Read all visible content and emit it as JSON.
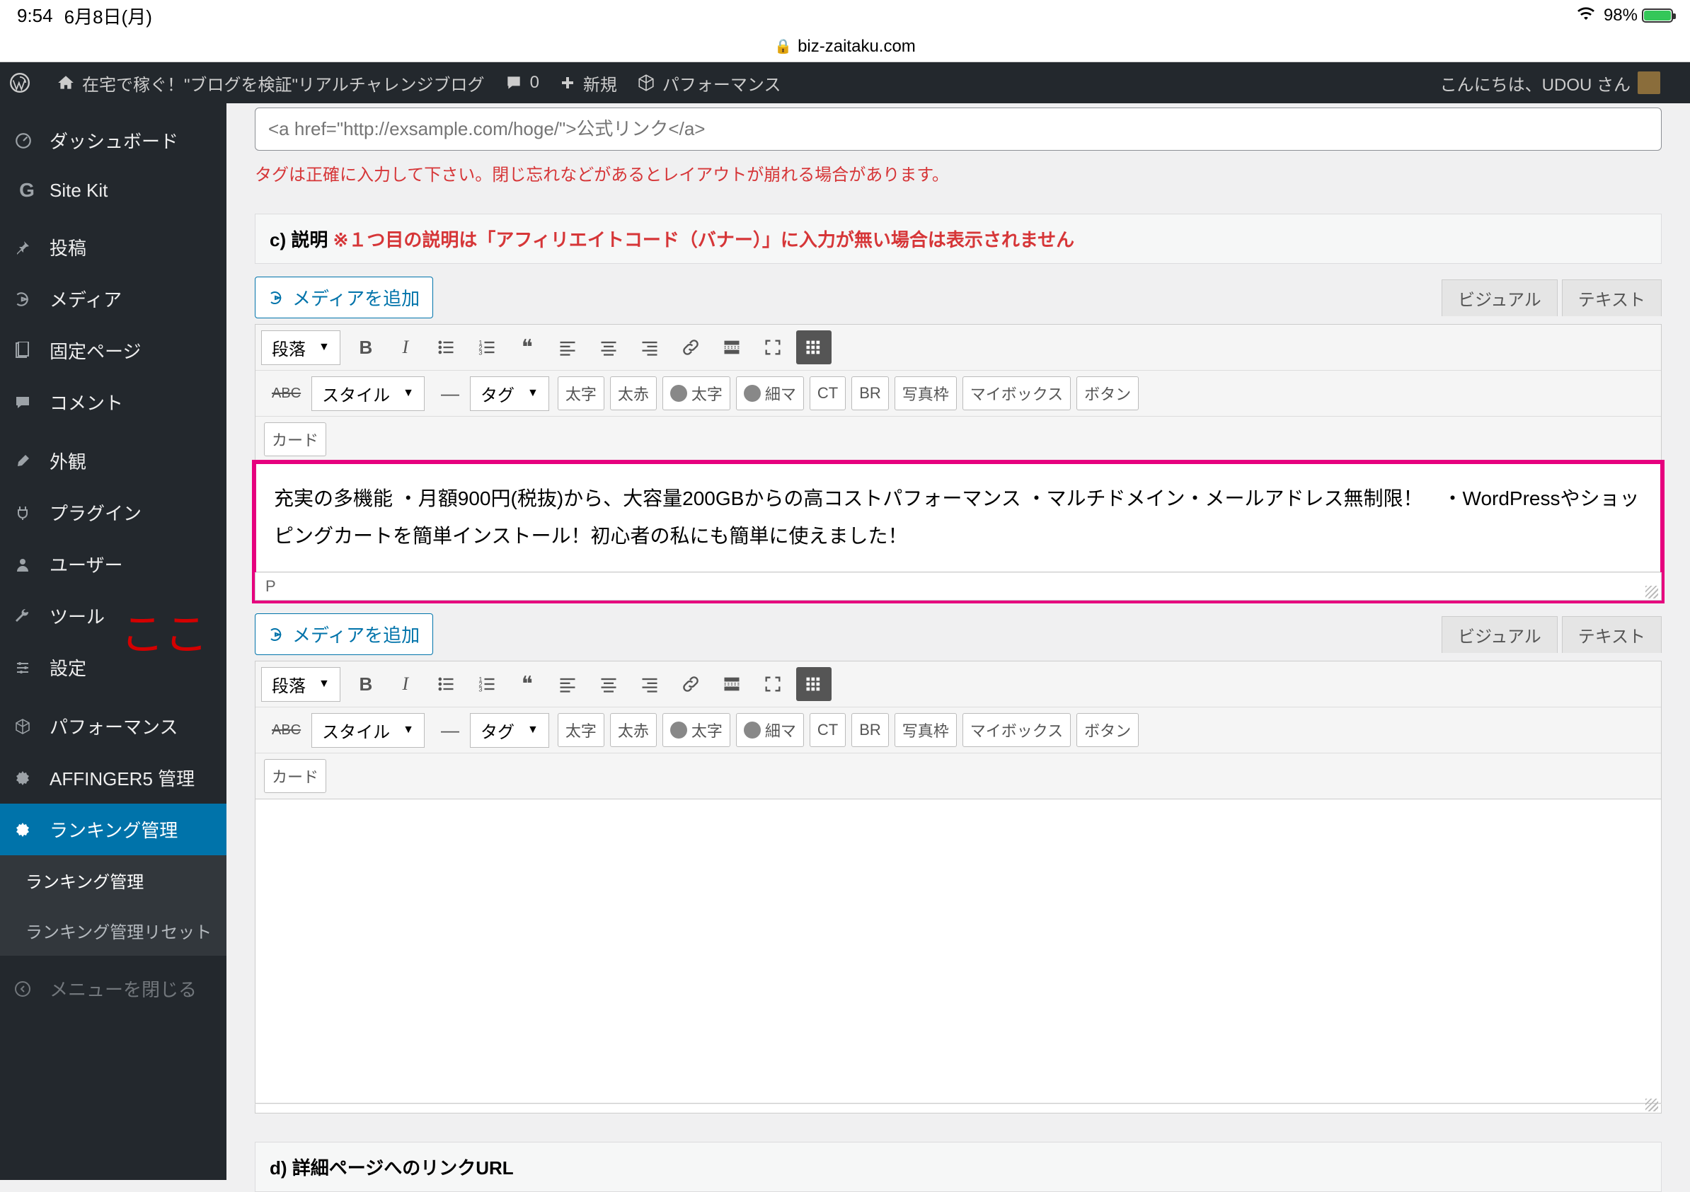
{
  "ios": {
    "time": "9:54",
    "date": "6月8日(月)",
    "battery": "98%",
    "url_host": "biz-zaitaku.com"
  },
  "adminbar": {
    "site_title": "在宅で稼ぐ！\"ブログを検証\"リアルチャレンジブログ",
    "comments": "0",
    "new": "新規",
    "performance": "パフォーマンス",
    "greeting": "こんにちは、UDOU さん"
  },
  "sidebar": {
    "dashboard": "ダッシュボード",
    "sitekit": "Site Kit",
    "posts": "投稿",
    "media": "メディア",
    "pages": "固定ページ",
    "comments": "コメント",
    "appearance": "外観",
    "plugins": "プラグイン",
    "users": "ユーザー",
    "tools": "ツール",
    "settings": "設定",
    "performance": "パフォーマンス",
    "affinger": "AFFINGER5 管理",
    "ranking": "ランキング管理",
    "sub_ranking": "ランキング管理",
    "sub_ranking_reset": "ランキング管理リセット",
    "collapse": "メニューを閉じる"
  },
  "content": {
    "annotation": "ここ",
    "link_placeholder": "<a href=\"http://exsample.com/hoge/\">公式リンク</a>",
    "link_hint": "タグは正確に入力して下さい。閉じ忘れなどがあるとレイアウトが崩れる場合があります。",
    "section_c_label": "c) 説明",
    "section_c_note": "※１つ目の説明は「アフィリエイトコード（バナー）」に入力が無い場合は表示されません",
    "section_d_label": "d) 詳細ページへのリンクURL",
    "media_add": "メディアを追加",
    "tab_visual": "ビジュアル",
    "tab_text": "テキスト",
    "paragraph_select": "段落",
    "style_select": "スタイル",
    "tag_select": "タグ",
    "btn_futoji": "太字",
    "btn_futoaka": "太赤",
    "btn_ava_futoji": "太字",
    "btn_ava_hosoma": "細マ",
    "btn_ct": "CT",
    "btn_br": "BR",
    "btn_photowaku": "写真枠",
    "btn_mybox": "マイボックス",
    "btn_button": "ボタン",
    "btn_card": "カード",
    "editor1_text": "充実の多機能 ・月額900円(税抜)から、大容量200GBからの高コストパフォーマンス ・マルチドメイン・メールアドレス無制限！　・WordPressやショッピングカートを簡単インストール！初心者の私にも簡単に使えました！",
    "editor_status": "P"
  }
}
